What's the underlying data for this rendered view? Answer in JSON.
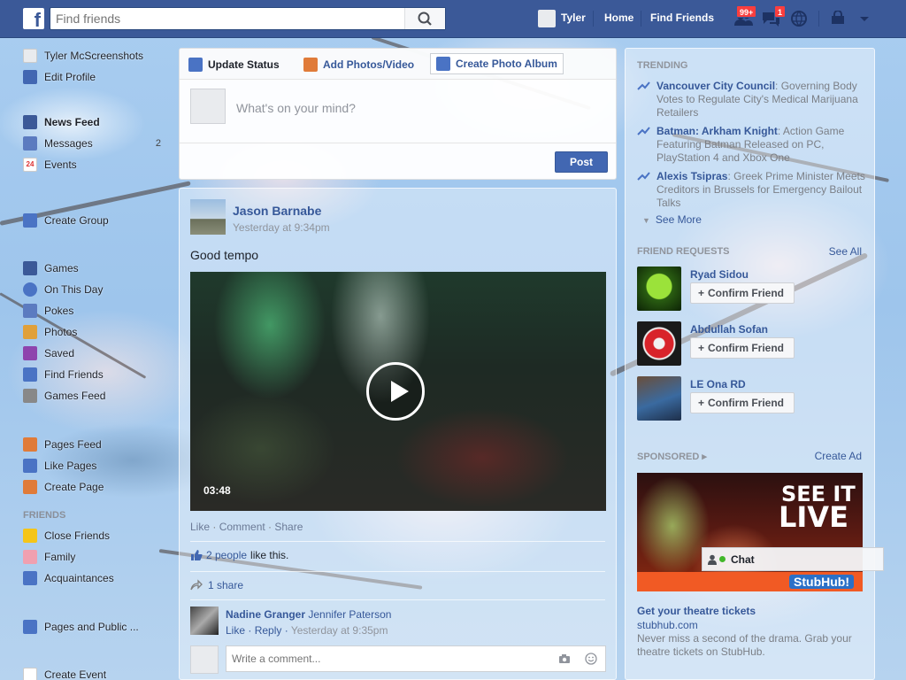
{
  "topbar": {
    "logo": "f",
    "search_placeholder": "Find friends",
    "user_name": "Tyler",
    "home_label": "Home",
    "find_friends_label": "Find Friends",
    "friend_requests_badge": "99+",
    "messages_badge": "1"
  },
  "leftnav": {
    "items": [
      {
        "label": "Tyler McScreenshots",
        "count": ""
      },
      {
        "label": "Edit Profile",
        "count": ""
      },
      {
        "label": "News Feed",
        "count": ""
      },
      {
        "label": "Messages",
        "count": "2"
      },
      {
        "label": "Events",
        "count": ""
      },
      {
        "label": "Create Group",
        "count": ""
      },
      {
        "label": "Games",
        "count": ""
      },
      {
        "label": "On This Day",
        "count": ""
      },
      {
        "label": "Pokes",
        "count": ""
      },
      {
        "label": "Photos",
        "count": ""
      },
      {
        "label": "Saved",
        "count": ""
      },
      {
        "label": "Find Friends",
        "count": ""
      },
      {
        "label": "Games Feed",
        "count": ""
      },
      {
        "label": "Pages Feed",
        "count": ""
      },
      {
        "label": "Like Pages",
        "count": ""
      },
      {
        "label": "Create Page",
        "count": ""
      },
      {
        "label": "Close Friends",
        "count": ""
      },
      {
        "label": "Family",
        "count": ""
      },
      {
        "label": "Acquaintances",
        "count": ""
      },
      {
        "label": "Pages and Public ...",
        "count": ""
      },
      {
        "label": "Create Event",
        "count": ""
      }
    ],
    "events_date": "24",
    "friends_section": "FRIENDS"
  },
  "composer": {
    "tab_status": "Update Status",
    "tab_photo": "Add Photos/Video",
    "tab_album": "Create Photo Album",
    "placeholder": "What's on your mind?",
    "post_label": "Post"
  },
  "story": {
    "author": "Jason Barnabe",
    "time": "Yesterday at 9:34pm",
    "message": "Good tempo",
    "video_duration": "03:48",
    "action_like": "Like",
    "action_comment": "Comment",
    "action_share": "Share",
    "likes_count": "2 people",
    "likes_suffix": "like this.",
    "shares": "1 share",
    "comment": {
      "author": "Nadine Granger",
      "tag": "Jennifer Paterson",
      "like": "Like",
      "reply": "Reply",
      "time": "Yesterday at 9:35pm"
    },
    "write_placeholder": "Write a comment..."
  },
  "trending": {
    "header": "TRENDING",
    "items": [
      {
        "title": "Vancouver City Council",
        "text": ": Governing Body Votes to Regulate City's Medical Marijuana Retailers"
      },
      {
        "title": "Batman: Arkham Knight",
        "text": ": Action Game Featuring Batman Released on PC, PlayStation 4 and Xbox One"
      },
      {
        "title": "Alexis Tsipras",
        "text": ": Greek Prime Minister Meets Creditors in Brussels for Emergency Bailout Talks"
      }
    ],
    "see_more": "See More"
  },
  "friend_requests": {
    "header": "FRIEND REQUESTS",
    "see_all": "See All",
    "button_label": "Confirm Friend",
    "items": [
      {
        "name": "Ryad Sidou"
      },
      {
        "name": "Abdullah Sofan"
      },
      {
        "name": "LE Ona RD"
      }
    ]
  },
  "sponsored": {
    "header": "SPONSORED",
    "create_ad": "Create Ad",
    "image_line1": "SEE IT",
    "image_line2": "LIVE",
    "image_brand": "StubHub!",
    "title": "Get your theatre tickets",
    "url": "stubhub.com",
    "description": "Never miss a second of the drama. Grab your theatre tickets on StubHub."
  },
  "chat": {
    "label": "Chat"
  },
  "colors": {
    "brand": "#3b5998",
    "link": "#365899",
    "badge": "#fa3e3e",
    "button": "#4267b2"
  }
}
